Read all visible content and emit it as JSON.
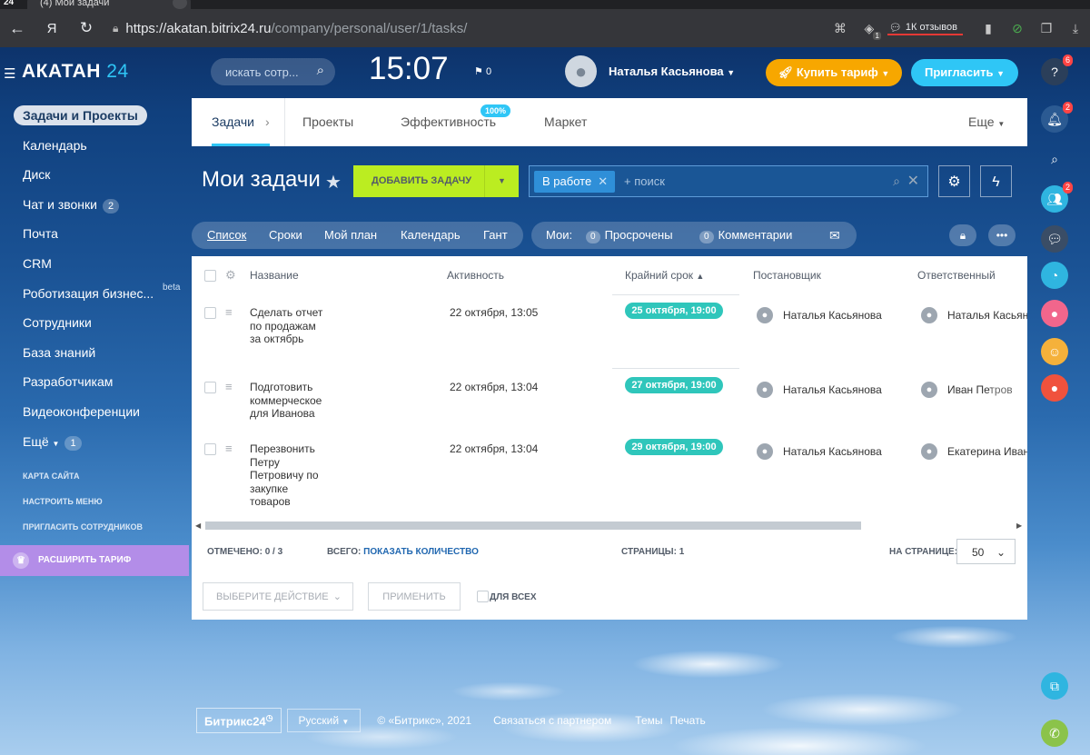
{
  "browser": {
    "tab_title": "(4) Мои задачи",
    "tab_logo": "24",
    "url_host": "https://akatan.bitrix24.ru",
    "url_path": "/company/personal/user/1/tasks/",
    "reviews": "1К отзывов",
    "tab_badge": "1"
  },
  "header": {
    "logo_name": "АКАТАН",
    "logo_num": "24",
    "search_placeholder": "искать сотр...",
    "clock": "15:07",
    "flag_count": "0",
    "user_name": "Наталья Касьянова",
    "buy_label": "Купить тариф",
    "invite_label": "Пригласить"
  },
  "left_menu": {
    "items": [
      {
        "label": "Задачи и Проекты"
      },
      {
        "label": "Календарь"
      },
      {
        "label": "Диск"
      },
      {
        "label": "Чат и звонки",
        "count": "2"
      },
      {
        "label": "Почта"
      },
      {
        "label": "CRM"
      },
      {
        "label": "Роботизация бизнес...",
        "extra": "beta"
      },
      {
        "label": "Сотрудники"
      },
      {
        "label": "База знаний"
      },
      {
        "label": "Разработчикам"
      },
      {
        "label": "Видеоконференции"
      },
      {
        "label": "Ещё",
        "count": "1"
      }
    ],
    "small": [
      "КАРТА САЙТА",
      "НАСТРОИТЬ МЕНЮ",
      "ПРИГЛАСИТЬ СОТРУДНИКОВ"
    ],
    "tariff": "РАСШИРИТЬ ТАРИФ"
  },
  "right_panel": {
    "help_badge": "6",
    "notif_badge": "2",
    "group_badge": "2"
  },
  "nav_tabs": {
    "tasks": "Задачи",
    "projects": "Проекты",
    "efficiency": "Эффективность",
    "efficiency_badge": "100%",
    "market": "Маркет",
    "more": "Еще"
  },
  "toolbar": {
    "title": "Мои задачи",
    "add_task": "ДОБАВИТЬ ЗАДАЧУ",
    "filter_chip": "В работе",
    "filter_placeholder": "+ поиск"
  },
  "views": {
    "list": "Список",
    "deadlines": "Сроки",
    "myplan": "Мой план",
    "calendar": "Календарь",
    "gantt": "Гант"
  },
  "counters": {
    "mine": "Мои:",
    "overdue_count": "0",
    "overdue": "Просрочены",
    "comments_count": "0",
    "comments": "Комментарии"
  },
  "grid": {
    "columns": {
      "name": "Название",
      "activity": "Активность",
      "deadline": "Крайний срок",
      "creator": "Постановщик",
      "responsible": "Ответственный"
    },
    "rows": [
      {
        "name": "Сделать отчет по продажам за октябрь",
        "activity": "22 октября, 13:05",
        "deadline": "25 октября, 19:00",
        "creator": "Наталья Касьянова",
        "responsible": "Наталья Касьянова"
      },
      {
        "name": "Подготовить коммерческое для Иванова",
        "activity": "22 октября, 13:04",
        "deadline": "27 октября, 19:00",
        "creator": "Наталья Касьянова",
        "responsible": "Иван Петров"
      },
      {
        "name": "Перезвонить Петру Петровичу по закупке товаров",
        "activity": "22 октября, 13:04",
        "deadline": "29 октября, 19:00",
        "creator": "Наталья Касьянова",
        "responsible": "Екатерина Иванова"
      }
    ],
    "footer": {
      "checked_label": "ОТМЕЧЕНО:",
      "checked_value": "0 / 3",
      "total_label": "ВСЕГО:",
      "total_link": "ПОКАЗАТЬ КОЛИЧЕСТВО",
      "pages_label": "СТРАНИЦЫ:",
      "pages_value": "1",
      "per_page_label": "НА СТРАНИЦЕ:",
      "per_page_value": "50"
    },
    "actions": {
      "select_action": "ВЫБЕРИТЕ ДЕЙСТВИЕ",
      "apply": "ПРИМЕНИТЬ",
      "for_all": "ДЛЯ ВСЕХ"
    }
  },
  "footer": {
    "brand": "Битрикс24",
    "lang": "Русский",
    "copyright": "© «Битрикс», 2021",
    "partner": "Связаться с партнером",
    "themes": "Темы",
    "print": "Печать"
  },
  "colors": {
    "accent": "#2fc6f6",
    "add_button": "#bbed21",
    "buy_button": "#f7a700",
    "deadline_badge": "#2fc6bb",
    "tariff": "#b38de8"
  }
}
